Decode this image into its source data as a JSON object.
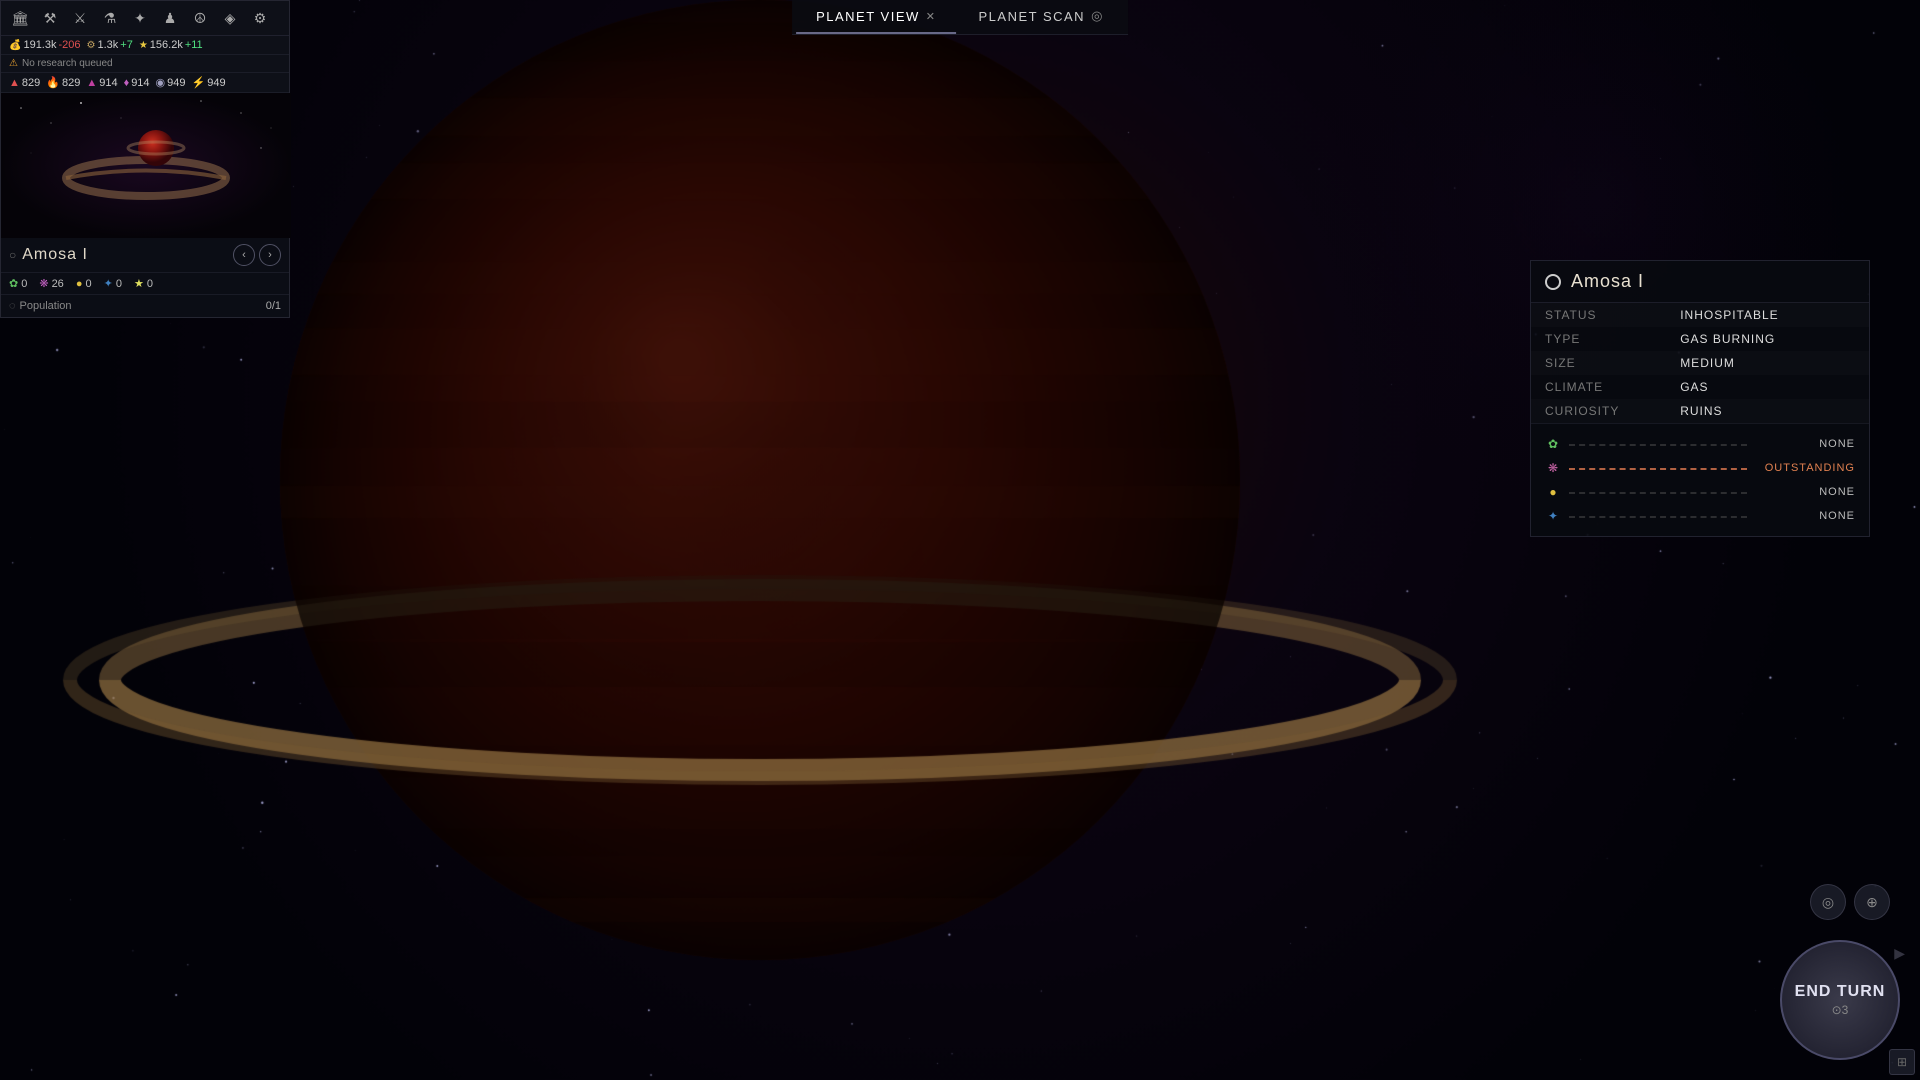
{
  "background": {
    "description": "Deep space background with large red gas giant planet with rings"
  },
  "top_tabs": {
    "planet_view": {
      "label": "PLANET VIEW",
      "active": true,
      "has_close": true
    },
    "planet_scan": {
      "label": "PLANET SCAN",
      "active": false
    }
  },
  "left_panel": {
    "top_icons": [
      {
        "name": "colony-icon",
        "symbol": "🏛"
      },
      {
        "name": "buildings-icon",
        "symbol": "🏗"
      },
      {
        "name": "units-icon",
        "symbol": "⚔"
      },
      {
        "name": "tech-icon",
        "symbol": "⚗"
      },
      {
        "name": "ships-icon",
        "symbol": "✈"
      },
      {
        "name": "heroes-icon",
        "symbol": "👑"
      },
      {
        "name": "diplomacy-icon",
        "symbol": "🤝"
      },
      {
        "name": "empire-icon",
        "symbol": "🌐"
      },
      {
        "name": "settings-icon",
        "symbol": "⚙"
      }
    ],
    "resources": {
      "dust": {
        "value": "191.3k",
        "change": "-206",
        "icon": "💰"
      },
      "industry": {
        "value": "1.3k",
        "change": "+7",
        "icon": "🏭"
      },
      "science": {
        "value": "156.2k",
        "change": "+11",
        "icon": "⭐"
      }
    },
    "research": {
      "label": "No research queued",
      "icon": "⚠"
    },
    "stats": [
      {
        "icon": "🔴",
        "value": "829",
        "color": "red"
      },
      {
        "icon": "🔥",
        "value": "829",
        "color": "orange"
      },
      {
        "icon": "🔴",
        "value": "914",
        "color": "red"
      },
      {
        "icon": "💎",
        "value": "914",
        "color": "pink"
      },
      {
        "icon": "⚪",
        "value": "949",
        "color": "white"
      },
      {
        "icon": "⚡",
        "value": "949",
        "color": "yellow"
      }
    ],
    "planet_name": "Amosa I",
    "planet_resources": [
      {
        "icon": "🌿",
        "value": "0",
        "name": "food-res"
      },
      {
        "icon": "🔮",
        "value": "26",
        "name": "influence-res"
      },
      {
        "icon": "💛",
        "value": "0",
        "name": "gold-res"
      },
      {
        "icon": "🔵",
        "value": "0",
        "name": "manpower-res"
      },
      {
        "icon": "⭐",
        "value": "0",
        "name": "approval-res"
      }
    ],
    "population": {
      "label": "Population",
      "current": "0",
      "max": "1",
      "display": "0/1"
    }
  },
  "planet_info": {
    "name": "Amosa I",
    "fields": [
      {
        "key": "STATUS",
        "value": "INHOSPITABLE"
      },
      {
        "key": "TYPE",
        "value": "GAS BURNING"
      },
      {
        "key": "SIZE",
        "value": "MEDIUM"
      },
      {
        "key": "CLIMATE",
        "value": "GAS"
      },
      {
        "key": "CURIOSITY",
        "value": "RUINS"
      }
    ],
    "resource_bars": [
      {
        "icon": "🌿",
        "level": "none",
        "label": "NONE",
        "is_outstanding": false,
        "color": "green"
      },
      {
        "icon": "🔮",
        "level": "outstanding",
        "label": "OUTSTANDING",
        "is_outstanding": true,
        "color": "orange"
      },
      {
        "icon": "💛",
        "level": "none",
        "label": "NONE",
        "is_outstanding": false,
        "color": "gold"
      },
      {
        "icon": "🔵",
        "level": "none",
        "label": "NONE",
        "is_outstanding": false,
        "color": "blue"
      }
    ]
  },
  "end_turn": {
    "label": "END TURN",
    "sub": "⊙3"
  },
  "bottom_nav": {
    "left_arrow": "◀",
    "right_arrow": "▶",
    "up_arrow": "▲",
    "down_arrow": "▼",
    "nav_icon1": "◎",
    "nav_icon2": "⊕"
  }
}
